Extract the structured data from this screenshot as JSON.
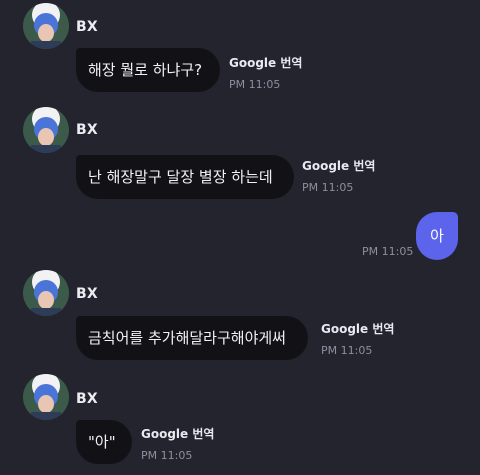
{
  "colors": {
    "background": "#24242f",
    "incoming_bubble": "#111116",
    "outgoing_bubble": "#5b64ea",
    "timestamp": "#8e8ea0"
  },
  "messages": [
    {
      "sender": "BX",
      "text": "해장 뭘로 하냐구?",
      "translate_label": "Google 번역",
      "time": "PM 11:05"
    },
    {
      "sender": "BX",
      "text": "난 해장말구 달장 별장 하는데",
      "translate_label": "Google 번역",
      "time": "PM 11:05"
    },
    {
      "sender": "me",
      "text": "아",
      "time": "PM 11:05"
    },
    {
      "sender": "BX",
      "text": "금칙어를 추가해달라구해야게써",
      "translate_label": "Google 번역",
      "time": "PM 11:05"
    },
    {
      "sender": "BX",
      "text": "\"아\"",
      "translate_label": "Google 번역",
      "time": "PM 11:05"
    }
  ]
}
